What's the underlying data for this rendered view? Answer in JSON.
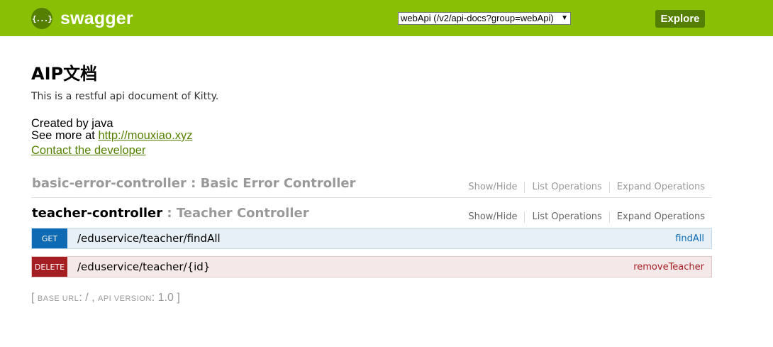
{
  "header": {
    "logo_symbol": "{...}",
    "logo_text": "swagger",
    "api_select": "webApi (/v2/api-docs?group=webApi)",
    "explore_label": "Explore"
  },
  "info": {
    "title": "AIP文档",
    "description": "This is a restful api document of Kitty.",
    "created_by": "Created by java",
    "see_more_prefix": "See more at ",
    "see_more_link": "http://mouxiao.xyz",
    "contact": "Contact the developer"
  },
  "resources": [
    {
      "name": "basic-error-controller",
      "separator": " : ",
      "description": "Basic Error Controller",
      "options": [
        "Show/Hide",
        "List Operations",
        "Expand Operations"
      ]
    },
    {
      "name": "teacher-controller",
      "separator": " : ",
      "description": "Teacher Controller",
      "options": [
        "Show/Hide",
        "List Operations",
        "Expand Operations"
      ],
      "operations": [
        {
          "method": "GET",
          "path": "/eduservice/teacher/findAll",
          "nickname": "findAll"
        },
        {
          "method": "DELETE",
          "path": "/eduservice/teacher/{id}",
          "nickname": "removeTeacher"
        }
      ]
    }
  ],
  "footer": {
    "open": "[ ",
    "base_url_label": "BASE URL",
    "base_url_value": ": / , ",
    "api_version_label": "API VERSION",
    "api_version_value": ": 1.0 ",
    "close": "]"
  },
  "colors": {
    "header": "#89bf04",
    "brand_dark": "#547f00",
    "get": "#0f6ab4",
    "delete": "#a41e22"
  }
}
